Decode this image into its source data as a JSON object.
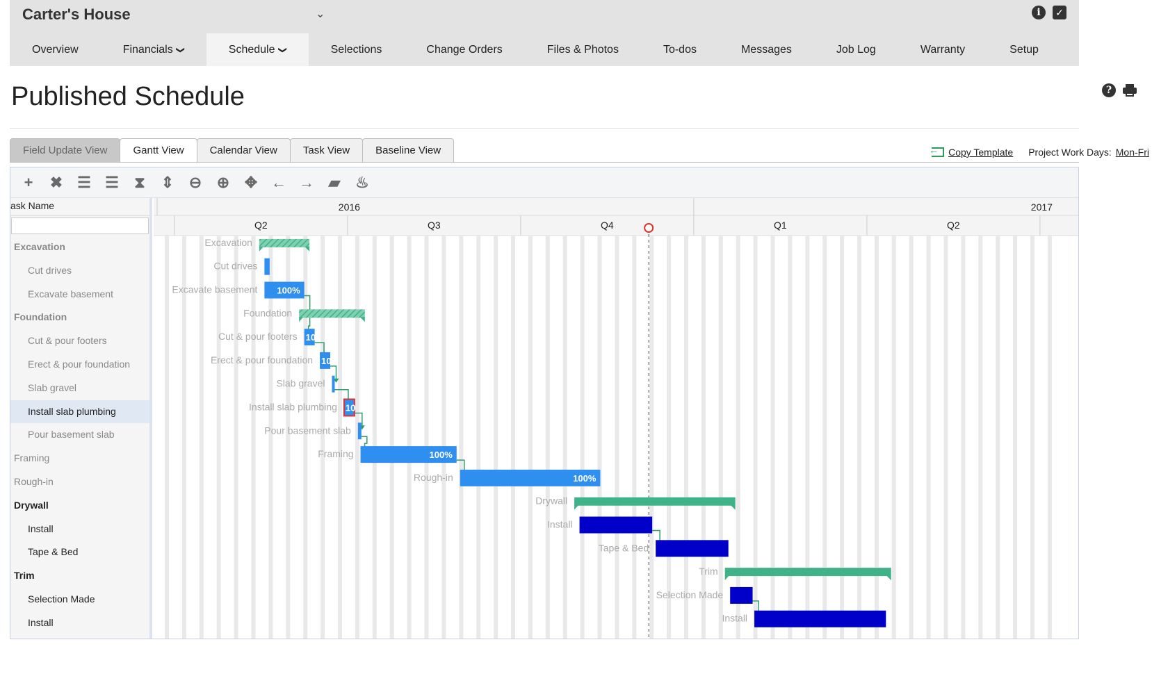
{
  "header": {
    "project_name": "Carter's House",
    "nav": [
      {
        "label": "Overview"
      },
      {
        "label": "Financials",
        "dropdown": true
      },
      {
        "label": "Schedule",
        "dropdown": true,
        "active": true
      },
      {
        "label": "Selections"
      },
      {
        "label": "Change Orders"
      },
      {
        "label": "Files & Photos"
      },
      {
        "label": "To-dos"
      },
      {
        "label": "Messages"
      },
      {
        "label": "Job Log"
      },
      {
        "label": "Warranty"
      },
      {
        "label": "Setup"
      }
    ]
  },
  "page": {
    "title": "Published Schedule",
    "tabs": [
      {
        "label": "Field Update View",
        "state": "disabled"
      },
      {
        "label": "Gantt View",
        "state": "active"
      },
      {
        "label": "Calendar View",
        "state": "normal"
      },
      {
        "label": "Task View",
        "state": "normal"
      },
      {
        "label": "Baseline View",
        "state": "normal"
      }
    ],
    "copy_template": "Copy Template",
    "work_days_label": "Project Work Days:",
    "work_days_value": "Mon-Fri"
  },
  "toolbar": [
    "add-icon",
    "delete-icon",
    "indent-icon",
    "outdent-icon",
    "collapse-all-icon",
    "expand-all-icon",
    "zoom-out-icon",
    "zoom-in-icon",
    "fit-icon",
    "move-left-icon",
    "move-right-icon",
    "tag-icon",
    "critical-path-icon"
  ],
  "colors": {
    "summary_bar": "#3fb28a",
    "completed_bar": "#2f8ff0",
    "active_bar": "#0000c8",
    "dependency": "#2e9e68",
    "today": "#e03030"
  },
  "gantt": {
    "task_column_header": "ask Name",
    "years": [
      {
        "label": "2016",
        "start": 0,
        "end": 31
      },
      {
        "label": "2017",
        "start": 31,
        "end": 52
      }
    ],
    "quarters": [
      {
        "label": "Q2",
        "start": 1,
        "end": 11
      },
      {
        "label": "Q3",
        "start": 11,
        "end": 21
      },
      {
        "label": "Q4",
        "start": 21,
        "end": 31
      },
      {
        "label": "Q1",
        "start": 31,
        "end": 41
      },
      {
        "label": "Q2",
        "start": 41,
        "end": 51
      }
    ],
    "today": 28.4,
    "tasks": [
      {
        "name": "Excavation",
        "level": "group",
        "type": "summary",
        "start": 5.9,
        "end": 8.8
      },
      {
        "name": "Cut drives",
        "level": "sub",
        "type": "task",
        "start": 6.2,
        "end": 6.5,
        "complete": 100
      },
      {
        "name": "Excavate basement",
        "level": "sub",
        "type": "task",
        "start": 6.2,
        "end": 8.5,
        "complete": 100,
        "label": "100%"
      },
      {
        "name": "Foundation",
        "level": "group",
        "type": "summary",
        "start": 8.2,
        "end": 12.0
      },
      {
        "name": "Cut & pour footers",
        "level": "sub",
        "type": "task",
        "start": 8.5,
        "end": 9.1,
        "complete": 100,
        "label": "10"
      },
      {
        "name": "Erect & pour foundation",
        "level": "sub",
        "type": "task",
        "start": 9.4,
        "end": 10.0,
        "complete": 100,
        "label": "10"
      },
      {
        "name": "Slab gravel",
        "level": "sub",
        "type": "task",
        "start": 10.1,
        "end": 10.25,
        "complete": 100
      },
      {
        "name": "Install slab plumbing",
        "level": "sub",
        "type": "task",
        "start": 10.8,
        "end": 11.4,
        "complete": 100,
        "label": "10",
        "selected": true
      },
      {
        "name": "Pour basement slab",
        "level": "sub",
        "type": "task",
        "start": 11.6,
        "end": 11.8,
        "complete": 100
      },
      {
        "name": "Framing",
        "level": "plain",
        "type": "task",
        "start": 11.75,
        "end": 17.3,
        "complete": 100,
        "label": "100%"
      },
      {
        "name": "Rough-in",
        "level": "plain",
        "type": "task",
        "start": 17.5,
        "end": 25.6,
        "complete": 100,
        "label": "100%"
      },
      {
        "name": "Drywall",
        "level": "group-black",
        "type": "summary",
        "start": 24.1,
        "end": 33.4
      },
      {
        "name": "Install",
        "level": "sub-black",
        "type": "active",
        "start": 24.4,
        "end": 28.6
      },
      {
        "name": "Tape & Bed",
        "level": "sub-black",
        "type": "active",
        "start": 28.8,
        "end": 33.0
      },
      {
        "name": "Trim",
        "level": "group-black",
        "type": "summary",
        "start": 32.8,
        "end": 42.4
      },
      {
        "name": "Selection Made",
        "level": "sub-black",
        "type": "active",
        "start": 33.1,
        "end": 34.4
      },
      {
        "name": "Install",
        "level": "sub-black",
        "type": "active",
        "start": 34.5,
        "end": 42.1
      }
    ],
    "dependencies": [
      [
        2,
        4
      ],
      [
        4,
        5
      ],
      [
        5,
        6
      ],
      [
        6,
        7
      ],
      [
        7,
        8
      ],
      [
        8,
        9
      ],
      [
        9,
        10
      ],
      [
        12,
        13
      ],
      [
        15,
        16
      ]
    ]
  }
}
